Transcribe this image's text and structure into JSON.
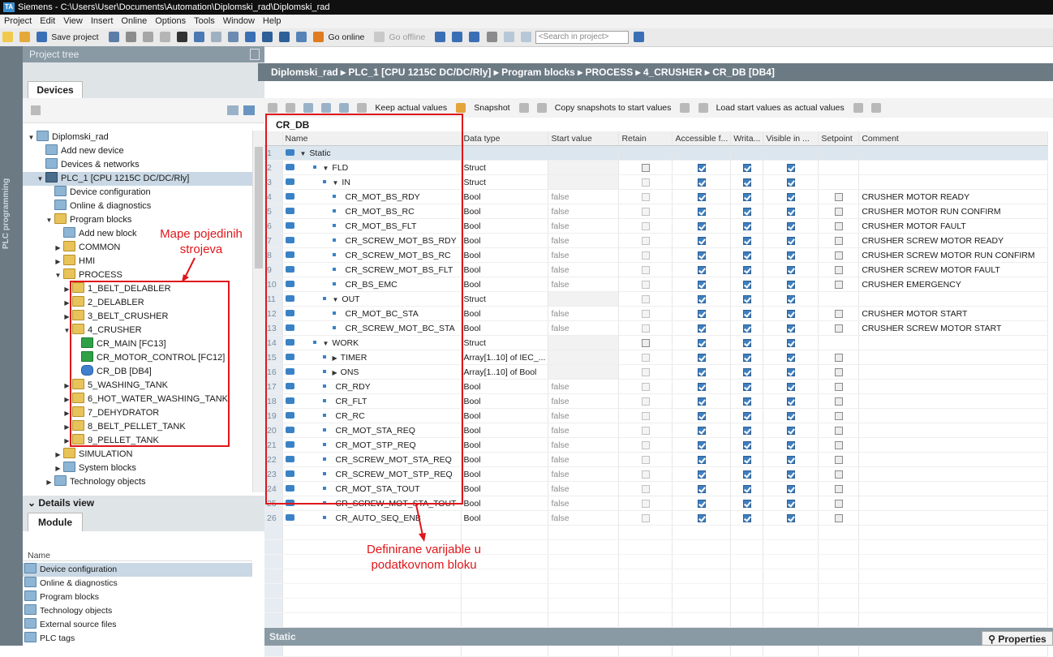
{
  "window": {
    "title": "Siemens  -  C:\\Users\\User\\Documents\\Automation\\Diplomski_rad\\Diplomski_rad"
  },
  "menu": [
    "Project",
    "Edit",
    "View",
    "Insert",
    "Online",
    "Options",
    "Tools",
    "Window",
    "Help"
  ],
  "toolbar": {
    "save_label": "Save project",
    "go_online": "Go online",
    "go_offline": "Go offline",
    "search_placeholder": "<Search in project>"
  },
  "side_strip_label": "PLC programming",
  "project_tree": {
    "header": "Project tree",
    "tab": "Devices",
    "items": [
      {
        "label": "Diplomski_rad",
        "level": 0,
        "icon": "project-icon",
        "twisty": "▼"
      },
      {
        "label": "Add new device",
        "level": 1,
        "icon": "add-device-icon",
        "twisty": ""
      },
      {
        "label": "Devices & networks",
        "level": 1,
        "icon": "network-icon",
        "twisty": ""
      },
      {
        "label": "PLC_1 [CPU 1215C DC/DC/Rly]",
        "level": 1,
        "icon": "plc-icon",
        "twisty": "▼",
        "selected": true
      },
      {
        "label": "Device configuration",
        "level": 2,
        "icon": "device-config-icon",
        "twisty": ""
      },
      {
        "label": "Online & diagnostics",
        "level": 2,
        "icon": "diagnostics-icon",
        "twisty": ""
      },
      {
        "label": "Program blocks",
        "level": 2,
        "icon": "folder-icon",
        "twisty": "▼"
      },
      {
        "label": "Add new block",
        "level": 3,
        "icon": "add-block-icon",
        "twisty": ""
      },
      {
        "label": "COMMON",
        "level": 3,
        "icon": "folder-icon",
        "twisty": "▶"
      },
      {
        "label": "HMI",
        "level": 3,
        "icon": "folder-icon",
        "twisty": "▶"
      },
      {
        "label": "PROCESS",
        "level": 3,
        "icon": "folder-icon",
        "twisty": "▼"
      },
      {
        "label": "1_BELT_DELABLER",
        "level": 4,
        "icon": "folder-icon",
        "twisty": "▶"
      },
      {
        "label": "2_DELABLER",
        "level": 4,
        "icon": "folder-icon",
        "twisty": "▶"
      },
      {
        "label": "3_BELT_CRUSHER",
        "level": 4,
        "icon": "folder-icon",
        "twisty": "▶"
      },
      {
        "label": "4_CRUSHER",
        "level": 4,
        "icon": "folder-icon",
        "twisty": "▼"
      },
      {
        "label": "CR_MAIN [FC13]",
        "level": 5,
        "icon": "function-icon",
        "twisty": ""
      },
      {
        "label": "CR_MOTOR_CONTROL [FC12]",
        "level": 5,
        "icon": "function-icon",
        "twisty": ""
      },
      {
        "label": "CR_DB [DB4]",
        "level": 5,
        "icon": "db-icon",
        "twisty": ""
      },
      {
        "label": "5_WASHING_TANK",
        "level": 4,
        "icon": "folder-icon",
        "twisty": "▶"
      },
      {
        "label": "6_HOT_WATER_WASHING_TANK",
        "level": 4,
        "icon": "folder-icon",
        "twisty": "▶"
      },
      {
        "label": "7_DEHYDRATOR",
        "level": 4,
        "icon": "folder-icon",
        "twisty": "▶"
      },
      {
        "label": "8_BELT_PELLET_TANK",
        "level": 4,
        "icon": "folder-icon",
        "twisty": "▶"
      },
      {
        "label": "9_PELLET_TANK",
        "level": 4,
        "icon": "folder-icon",
        "twisty": "▶"
      },
      {
        "label": "SIMULATION",
        "level": 3,
        "icon": "folder-icon",
        "twisty": "▶"
      },
      {
        "label": "System blocks",
        "level": 3,
        "icon": "system-folder-icon",
        "twisty": "▶"
      },
      {
        "label": "Technology objects",
        "level": 2,
        "icon": "technology-icon",
        "twisty": "▶"
      }
    ]
  },
  "details_view": {
    "header": "Details view",
    "tab": "Module",
    "column": "Name",
    "items": [
      {
        "label": "Device configuration",
        "selected": true
      },
      {
        "label": "Online & diagnostics"
      },
      {
        "label": "Program blocks"
      },
      {
        "label": "Technology objects"
      },
      {
        "label": "External source files"
      },
      {
        "label": "PLC tags"
      }
    ]
  },
  "breadcrumb": "Diplomski_rad  ▸  PLC_1 [CPU 1215C DC/DC/Rly]  ▸  Program blocks  ▸  PROCESS  ▸  4_CRUSHER  ▸  CR_DB [DB4]",
  "editor_toolbar": {
    "keep_actual": "Keep actual values",
    "snapshot": "Snapshot",
    "copy_snapshots": "Copy snapshots to start values",
    "load_start": "Load start values as actual values"
  },
  "db": {
    "title": "CR_DB",
    "columns": [
      "Name",
      "Data type",
      "Start value",
      "Retain",
      "Accessible f...",
      "Writa...",
      "Visible in ...",
      "Setpoint",
      "Comment"
    ],
    "rows": [
      {
        "n": "1",
        "indent": 0,
        "exp": "▼",
        "name": "Static",
        "type": "",
        "start": "",
        "retain": "",
        "acc": "",
        "wri": "",
        "vis": "",
        "set": "",
        "comment": ""
      },
      {
        "n": "2",
        "indent": 1,
        "exp": "▼",
        "name": "FLD",
        "type": "Struct",
        "start": "",
        "retain": "dk",
        "acc": "on",
        "wri": "on",
        "vis": "on",
        "set": "",
        "comment": ""
      },
      {
        "n": "3",
        "indent": 2,
        "exp": "▼",
        "name": "IN",
        "type": "Struct",
        "start": "",
        "retain": "off",
        "acc": "on",
        "wri": "on",
        "vis": "on",
        "set": "",
        "comment": ""
      },
      {
        "n": "4",
        "indent": 3,
        "exp": "",
        "name": "CR_MOT_BS_RDY",
        "type": "Bool",
        "start": "false",
        "retain": "off",
        "acc": "on",
        "wri": "on",
        "vis": "on",
        "set": "dk",
        "comment": "CRUSHER MOTOR READY"
      },
      {
        "n": "5",
        "indent": 3,
        "exp": "",
        "name": "CR_MOT_BS_RC",
        "type": "Bool",
        "start": "false",
        "retain": "off",
        "acc": "on",
        "wri": "on",
        "vis": "on",
        "set": "dk",
        "comment": "CRUSHER MOTOR RUN CONFIRM"
      },
      {
        "n": "6",
        "indent": 3,
        "exp": "",
        "name": "CR_MOT_BS_FLT",
        "type": "Bool",
        "start": "false",
        "retain": "off",
        "acc": "on",
        "wri": "on",
        "vis": "on",
        "set": "dk",
        "comment": "CRUSHER MOTOR FAULT"
      },
      {
        "n": "7",
        "indent": 3,
        "exp": "",
        "name": "CR_SCREW_MOT_BS_RDY",
        "type": "Bool",
        "start": "false",
        "retain": "off",
        "acc": "on",
        "wri": "on",
        "vis": "on",
        "set": "dk",
        "comment": "CRUSHER SCREW MOTOR READY"
      },
      {
        "n": "8",
        "indent": 3,
        "exp": "",
        "name": "CR_SCREW_MOT_BS_RC",
        "type": "Bool",
        "start": "false",
        "retain": "off",
        "acc": "on",
        "wri": "on",
        "vis": "on",
        "set": "dk",
        "comment": "CRUSHER SCREW MOTOR RUN CONFIRM"
      },
      {
        "n": "9",
        "indent": 3,
        "exp": "",
        "name": "CR_SCREW_MOT_BS_FLT",
        "type": "Bool",
        "start": "false",
        "retain": "off",
        "acc": "on",
        "wri": "on",
        "vis": "on",
        "set": "dk",
        "comment": "CRUSHER SCREW MOTOR FAULT"
      },
      {
        "n": "10",
        "indent": 3,
        "exp": "",
        "name": "CR_BS_EMC",
        "type": "Bool",
        "start": "false",
        "retain": "off",
        "acc": "on",
        "wri": "on",
        "vis": "on",
        "set": "dk",
        "comment": "CRUSHER EMERGENCY"
      },
      {
        "n": "11",
        "indent": 2,
        "exp": "▼",
        "name": "OUT",
        "type": "Struct",
        "start": "",
        "retain": "off",
        "acc": "on",
        "wri": "on",
        "vis": "on",
        "set": "",
        "comment": ""
      },
      {
        "n": "12",
        "indent": 3,
        "exp": "",
        "name": "CR_MOT_BC_STA",
        "type": "Bool",
        "start": "false",
        "retain": "off",
        "acc": "on",
        "wri": "on",
        "vis": "on",
        "set": "dk",
        "comment": "CRUSHER MOTOR START"
      },
      {
        "n": "13",
        "indent": 3,
        "exp": "",
        "name": "CR_SCREW_MOT_BC_STA",
        "type": "Bool",
        "start": "false",
        "retain": "off",
        "acc": "on",
        "wri": "on",
        "vis": "on",
        "set": "dk",
        "comment": "CRUSHER SCREW MOTOR START"
      },
      {
        "n": "14",
        "indent": 1,
        "exp": "▼",
        "name": "WORK",
        "type": "Struct",
        "start": "",
        "retain": "dk",
        "acc": "on",
        "wri": "on",
        "vis": "on",
        "set": "",
        "comment": ""
      },
      {
        "n": "15",
        "indent": 2,
        "exp": "▶",
        "name": "TIMER",
        "type": "Array[1..10] of IEC_...",
        "start": "",
        "retain": "off",
        "acc": "on",
        "wri": "on",
        "vis": "on",
        "set": "dk",
        "comment": ""
      },
      {
        "n": "16",
        "indent": 2,
        "exp": "▶",
        "name": "ONS",
        "type": "Array[1..10] of Bool",
        "start": "",
        "retain": "off",
        "acc": "on",
        "wri": "on",
        "vis": "on",
        "set": "dk",
        "comment": ""
      },
      {
        "n": "17",
        "indent": 2,
        "exp": "",
        "name": "CR_RDY",
        "type": "Bool",
        "start": "false",
        "retain": "off",
        "acc": "on",
        "wri": "on",
        "vis": "on",
        "set": "dk",
        "comment": ""
      },
      {
        "n": "18",
        "indent": 2,
        "exp": "",
        "name": "CR_FLT",
        "type": "Bool",
        "start": "false",
        "retain": "off",
        "acc": "on",
        "wri": "on",
        "vis": "on",
        "set": "dk",
        "comment": ""
      },
      {
        "n": "19",
        "indent": 2,
        "exp": "",
        "name": "CR_RC",
        "type": "Bool",
        "start": "false",
        "retain": "off",
        "acc": "on",
        "wri": "on",
        "vis": "on",
        "set": "dk",
        "comment": ""
      },
      {
        "n": "20",
        "indent": 2,
        "exp": "",
        "name": "CR_MOT_STA_REQ",
        "type": "Bool",
        "start": "false",
        "retain": "off",
        "acc": "on",
        "wri": "on",
        "vis": "on",
        "set": "dk",
        "comment": ""
      },
      {
        "n": "21",
        "indent": 2,
        "exp": "",
        "name": "CR_MOT_STP_REQ",
        "type": "Bool",
        "start": "false",
        "retain": "off",
        "acc": "on",
        "wri": "on",
        "vis": "on",
        "set": "dk",
        "comment": ""
      },
      {
        "n": "22",
        "indent": 2,
        "exp": "",
        "name": "CR_SCREW_MOT_STA_REQ",
        "type": "Bool",
        "start": "false",
        "retain": "off",
        "acc": "on",
        "wri": "on",
        "vis": "on",
        "set": "dk",
        "comment": ""
      },
      {
        "n": "23",
        "indent": 2,
        "exp": "",
        "name": "CR_SCREW_MOT_STP_REQ",
        "type": "Bool",
        "start": "false",
        "retain": "off",
        "acc": "on",
        "wri": "on",
        "vis": "on",
        "set": "dk",
        "comment": ""
      },
      {
        "n": "24",
        "indent": 2,
        "exp": "",
        "name": "CR_MOT_STA_TOUT",
        "type": "Bool",
        "start": "false",
        "retain": "off",
        "acc": "on",
        "wri": "on",
        "vis": "on",
        "set": "dk",
        "comment": ""
      },
      {
        "n": "25",
        "indent": 2,
        "exp": "",
        "name": "CR_SCREW_MOT_STA_TOUT",
        "type": "Bool",
        "start": "false",
        "retain": "off",
        "acc": "on",
        "wri": "on",
        "vis": "on",
        "set": "dk",
        "comment": ""
      },
      {
        "n": "26",
        "indent": 2,
        "exp": "",
        "name": "CR_AUTO_SEQ_ENB",
        "type": "Bool",
        "start": "false",
        "retain": "off",
        "acc": "on",
        "wri": "on",
        "vis": "on",
        "set": "dk",
        "comment": ""
      }
    ]
  },
  "status_bar": "Static",
  "properties_tab": "Properties",
  "annotations": {
    "machines": "Mape pojedinih strojeva",
    "variables": "Definirane varijable u podatkovnom bloku"
  },
  "colors": {
    "annotation": "#e0161a",
    "header_bg": "#6c7a84",
    "checkbox_on": "#3f7fc0"
  }
}
